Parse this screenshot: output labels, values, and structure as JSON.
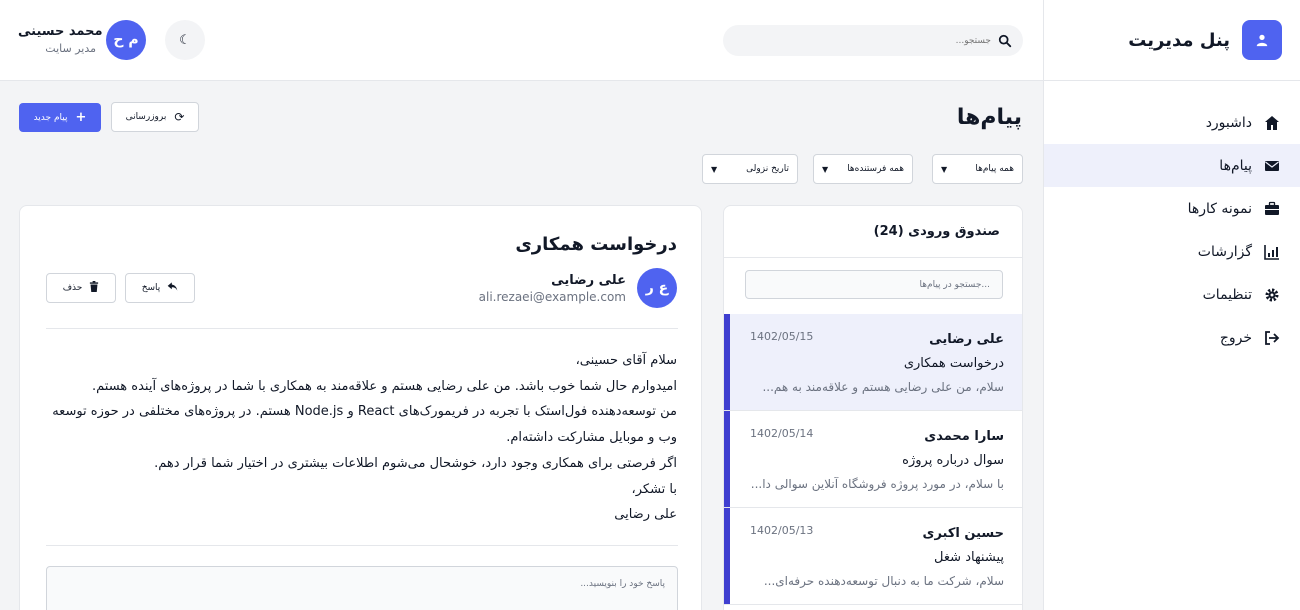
{
  "sidebar": {
    "brand": "پنل مدیریت",
    "items": [
      {
        "label": "داشبورد",
        "icon": "home-icon"
      },
      {
        "label": "پیام‌ها",
        "icon": "envelope-icon",
        "active": true
      },
      {
        "label": "نمونه کارها",
        "icon": "briefcase-icon"
      },
      {
        "label": "گزارشات",
        "icon": "chart-icon"
      },
      {
        "label": "تنظیمات",
        "icon": "gear-icon"
      },
      {
        "label": "خروج",
        "icon": "logout-icon"
      }
    ]
  },
  "header": {
    "search_placeholder": "جستجو...",
    "theme_icon": "moon-icon",
    "user": {
      "initials": "م ح",
      "name": "محمد حسینی",
      "role": "مدیر سایت"
    }
  },
  "page": {
    "title": "پیام‌ها",
    "new_message_label": "پیام جدید",
    "refresh_label": "بروزرسانی",
    "filters": [
      {
        "value": "همه پیام‌ها"
      },
      {
        "value": "همه فرستنده‌ها"
      },
      {
        "value": "تاریخ نزولی"
      }
    ]
  },
  "inbox": {
    "title": "صندوق ورودی (24)",
    "search_placeholder": "جستجو در پیام‌ها...",
    "messages": [
      {
        "sender": "علی رضایی",
        "date": "1402/05/15",
        "subject": "درخواست همکاری",
        "preview": "سلام، من علی رضایی هستم و علاقه‌مند به هم...",
        "active": true
      },
      {
        "sender": "سارا محمدی",
        "date": "1402/05/14",
        "subject": "سوال درباره پروژه",
        "preview": "با سلام، در مورد پروژه فروشگاه آنلاین سوالی دا..."
      },
      {
        "sender": "حسین اکبری",
        "date": "1402/05/13",
        "subject": "پیشنهاد شغل",
        "preview": "سلام، شرکت ما به دنبال توسعه‌دهنده حرفه‌ای..."
      }
    ]
  },
  "detail": {
    "title": "درخواست همکاری",
    "avatar_initials": "ع ر",
    "sender": "علی رضایی",
    "email": "ali.rezaei@example.com",
    "reply_label": "پاسخ",
    "delete_label": "حذف",
    "body_lines": [
      "سلام آقای حسینی،",
      "امیدوارم حال شما خوب باشد. من علی رضایی هستم و علاقه‌مند به همکاری با شما در پروژه‌های آینده هستم.",
      "من توسعه‌دهنده فول‌استک با تجربه در فریمورک‌های React و Node.js هستم. در پروژه‌های مختلفی در حوزه توسعه وب و موبایل مشارکت داشته‌ام.",
      "اگر فرصتی برای همکاری وجود دارد، خوشحال می‌شوم اطلاعات بیشتری در اختیار شما قرار دهم.",
      "با تشکر،",
      "علی رضایی"
    ],
    "reply_placeholder": "پاسخ خود را بنویسید..."
  },
  "colors": {
    "accent": "#4f63f0",
    "active_bar": "#3f3fd0",
    "active_bg": "#eef0fb"
  }
}
